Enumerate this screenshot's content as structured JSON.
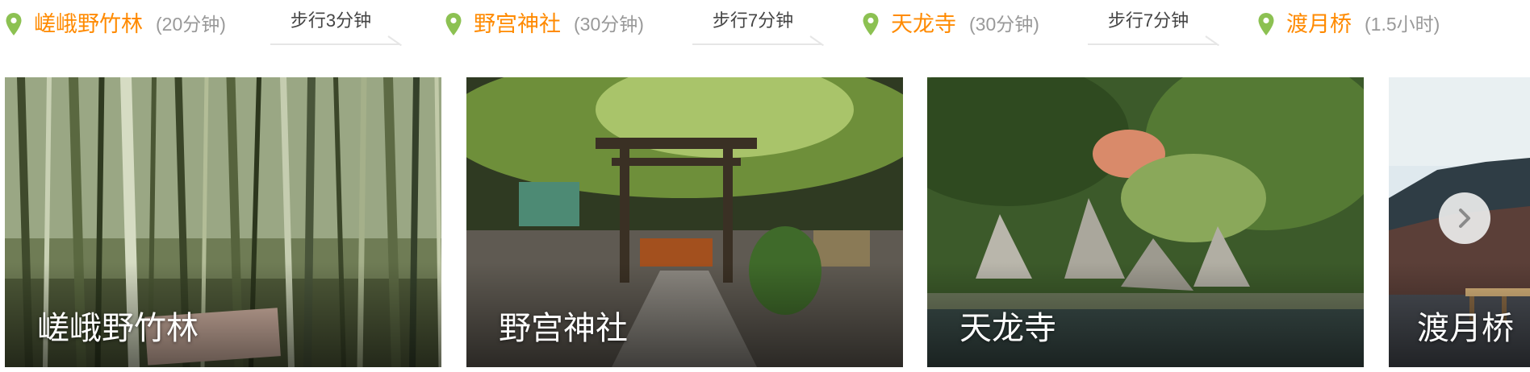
{
  "route": {
    "stops": [
      {
        "name": "嵯峨野竹林",
        "duration": "(20分钟)"
      },
      {
        "name": "野宫神社",
        "duration": "(30分钟)"
      },
      {
        "name": "天龙寺",
        "duration": "(30分钟)"
      },
      {
        "name": "渡月桥",
        "duration": "(1.5小时)"
      }
    ],
    "walks": [
      {
        "label": "步行3分钟"
      },
      {
        "label": "步行7分钟"
      },
      {
        "label": "步行7分钟"
      }
    ]
  },
  "cards": [
    {
      "title": "嵯峨野竹林"
    },
    {
      "title": "野宫神社"
    },
    {
      "title": "天龙寺"
    },
    {
      "title": "渡月桥"
    }
  ],
  "icons": {
    "pin": "map-pin-icon",
    "next": "chevron-right-icon"
  },
  "colors": {
    "stop_name": "#ff8a00",
    "pin": "#8cc152",
    "duration": "#999999",
    "walk_text": "#444444"
  }
}
